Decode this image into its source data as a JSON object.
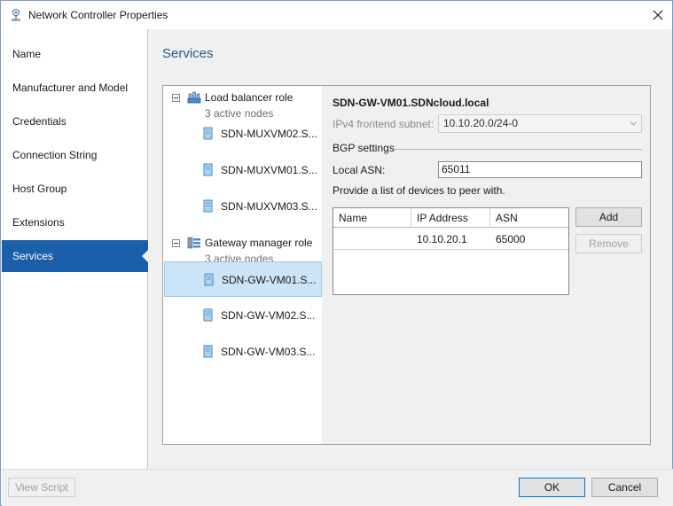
{
  "window": {
    "title": "Network Controller Properties"
  },
  "sidebar": {
    "items": [
      {
        "label": "Name"
      },
      {
        "label": "Manufacturer and Model"
      },
      {
        "label": "Credentials"
      },
      {
        "label": "Connection String"
      },
      {
        "label": "Host Group"
      },
      {
        "label": "Extensions"
      },
      {
        "label": "Services"
      }
    ],
    "active_index": 6
  },
  "main": {
    "title": "Services"
  },
  "tree": {
    "groups": [
      {
        "label": "Load balancer role",
        "subtitle": "3 active nodes",
        "icon": "load-balancer-icon",
        "nodes": [
          {
            "label": "SDN-MUXVM02.S..."
          },
          {
            "label": "SDN-MUXVM01.S..."
          },
          {
            "label": "SDN-MUXVM03.S..."
          }
        ]
      },
      {
        "label": "Gateway manager role",
        "subtitle": "3 active nodes",
        "icon": "gateway-manager-icon",
        "nodes": [
          {
            "label": "SDN-GW-VM01.S..."
          },
          {
            "label": "SDN-GW-VM02.S..."
          },
          {
            "label": "SDN-GW-VM03.S..."
          }
        ]
      }
    ],
    "selected_node": "SDN-GW-VM01.S..."
  },
  "details": {
    "name": "SDN-GW-VM01.SDNcloud.local",
    "ipv4_label": "IPv4 frontend subnet:",
    "ipv4_value": "10.10.20.0/24-0",
    "bgp_section": "BGP settings",
    "local_asn_label": "Local ASN:",
    "local_asn_value": "65011",
    "peer_note": "Provide a list of devices to peer with.",
    "grid": {
      "columns": [
        "Name",
        "IP Address",
        "ASN"
      ],
      "rows": [
        {
          "name": "",
          "ip": "10.10.20.1",
          "asn": "65000"
        }
      ]
    },
    "add_label": "Add",
    "remove_label": "Remove"
  },
  "footer": {
    "view_script_label": "View Script",
    "ok_label": "OK",
    "cancel_label": "Cancel"
  },
  "colors": {
    "accent": "#1b5ea9",
    "title_blue": "#2a5a8c",
    "selection": "#cce4f7"
  }
}
